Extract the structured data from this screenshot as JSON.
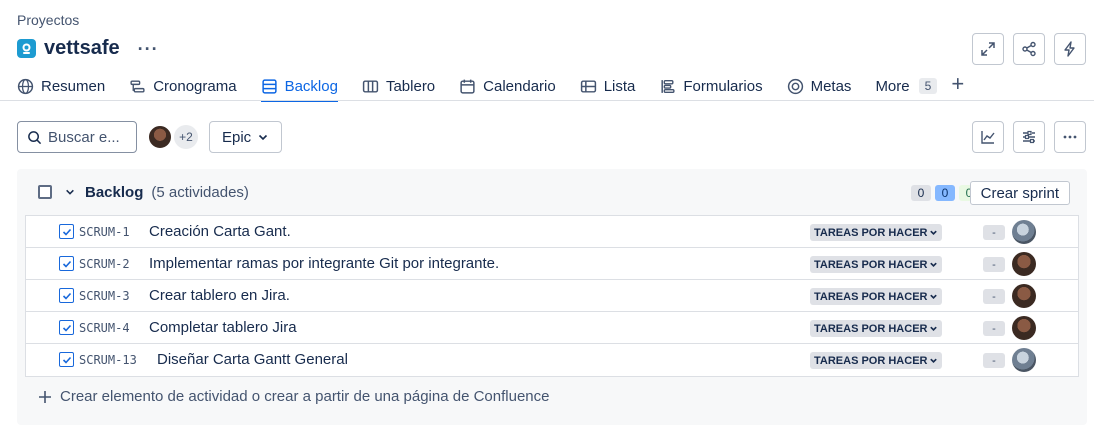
{
  "header": {
    "breadcrumb": "Proyectos",
    "project_name": "vettsafe",
    "more_label": "···"
  },
  "tabs": [
    {
      "label": "Resumen",
      "icon": "globe-icon"
    },
    {
      "label": "Cronograma",
      "icon": "timeline-icon"
    },
    {
      "label": "Backlog",
      "icon": "backlog-icon",
      "active": true
    },
    {
      "label": "Tablero",
      "icon": "board-icon"
    },
    {
      "label": "Calendario",
      "icon": "calendar-icon"
    },
    {
      "label": "Lista",
      "icon": "list-icon"
    },
    {
      "label": "Formularios",
      "icon": "forms-icon"
    },
    {
      "label": "Metas",
      "icon": "goals-icon"
    },
    {
      "label": "More",
      "badge": "5"
    }
  ],
  "toolbar": {
    "search_placeholder": "Buscar e...",
    "avatars_extra": "+2",
    "epic_label": "Epic"
  },
  "backlog": {
    "title": "Backlog",
    "count_label": "(5 actividades)",
    "status_counts": [
      "0",
      "0",
      "0"
    ],
    "create_sprint_label": "Crear sprint",
    "items": [
      {
        "key": "SCRUM-1",
        "summary": "Creación Carta Gant.",
        "status": "TAREAS POR HACER",
        "estimate": "-",
        "assignee": "avatar-light"
      },
      {
        "key": "SCRUM-2",
        "summary": "Implementar ramas por integrante Git por integrante.",
        "status": "TAREAS POR HACER",
        "estimate": "-",
        "assignee": "avatar-dark"
      },
      {
        "key": "SCRUM-3",
        "summary": "Crear tablero en Jira.",
        "status": "TAREAS POR HACER",
        "estimate": "-",
        "assignee": "avatar-dark"
      },
      {
        "key": "SCRUM-4",
        "summary": "Completar tablero Jira",
        "status": "TAREAS POR HACER",
        "estimate": "-",
        "assignee": "avatar-dark"
      },
      {
        "key": "SCRUM-13",
        "summary": "Diseñar Carta Gantt General",
        "status": "TAREAS POR HACER",
        "estimate": "-",
        "assignee": "avatar-light"
      }
    ],
    "create_item_label": "Crear elemento de actividad o crear a partir de una página de Confluence"
  },
  "colors": {
    "accent": "#0c66e4",
    "project_icon": "#1d9bd1",
    "text": "#172b4d"
  }
}
